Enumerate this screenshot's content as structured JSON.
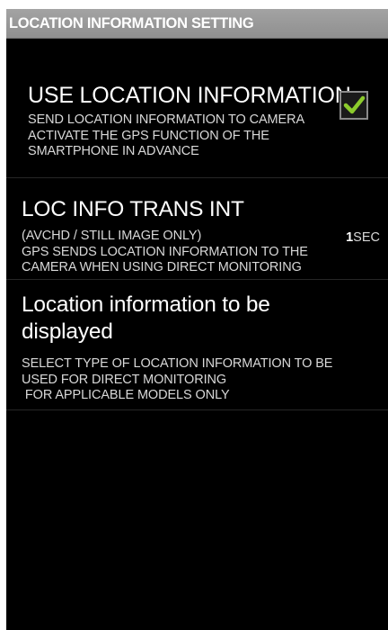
{
  "title_bar": {
    "title": "LOCATION INFORMATION SETTING"
  },
  "settings": {
    "use_location": {
      "title": "USE LOCATION INFORMATION",
      "summary_lines": [
        "SEND LOCATION INFORMATION TO CAMERA",
        "ACTIVATE THE GPS FUNCTION OF THE",
        "SMARTPHONE IN ADVANCE"
      ],
      "checked": true
    },
    "trans_interval": {
      "title": "LOC INFO TRANS INT",
      "summary_lines": [
        "(AVCHD / STILL IMAGE ONLY)",
        "GPS SENDS LOCATION INFORMATION TO THE",
        "CAMERA WHEN USING DIRECT MONITORING"
      ],
      "value": "1",
      "unit": "SEC"
    },
    "display_type": {
      "title_lines": [
        "Location information to be",
        "displayed"
      ],
      "summary_lines": [
        "SELECT TYPE OF LOCATION INFORMATION TO BE",
        "USED FOR DIRECT MONITORING",
        " FOR APPLICABLE MODELS ONLY"
      ]
    }
  },
  "colors": {
    "background": "#000000",
    "title_bar": "#9a9a9a",
    "check_green": "#8ccb2c"
  },
  "icons": {
    "checkbox": "checkmark-icon"
  }
}
